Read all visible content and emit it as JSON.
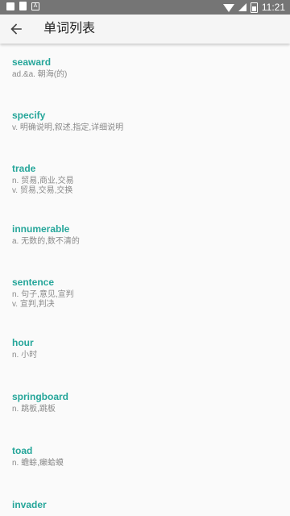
{
  "status_bar": {
    "time": "11:21",
    "icons": [
      "image-icon",
      "document-icon",
      "a-icon",
      "wifi-icon",
      "signal-icon",
      "battery-icon"
    ]
  },
  "app_bar": {
    "title": "单词列表",
    "back_icon": "arrow-left-icon"
  },
  "colors": {
    "word": "#26a69a",
    "meaning": "#8a8a8a",
    "status_bar": "#757575",
    "background": "#fafafa"
  },
  "words": [
    {
      "word": "seaward",
      "meaning": "ad.&a. 朝海(的)"
    },
    {
      "word": "specify",
      "meaning": "v. 明确说明,叙述,指定,详细说明"
    },
    {
      "word": "trade",
      "meaning": "n. 贸易,商业,交易\nv. 贸易,交易,交换"
    },
    {
      "word": "innumerable",
      "meaning": "a. 无数的,数不清的"
    },
    {
      "word": "sentence",
      "meaning": "n. 句子,意见,宣判\nv. 宣判,判决"
    },
    {
      "word": "hour",
      "meaning": "n. 小时"
    },
    {
      "word": "springboard",
      "meaning": "n. 跳板,跳板"
    },
    {
      "word": "toad",
      "meaning": "n. 蟾蜍,癞蛤蟆"
    },
    {
      "word": "invader",
      "meaning": ""
    }
  ]
}
